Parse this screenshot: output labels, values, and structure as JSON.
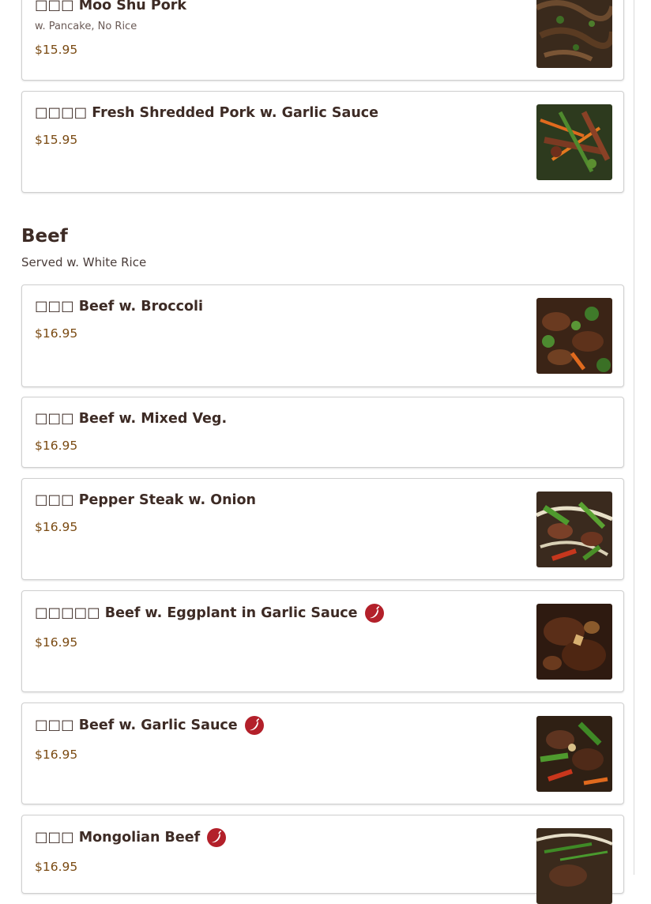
{
  "sections": {
    "previous_items": [
      {
        "name": "□□□ Moo Shu Pork",
        "description": "w. Pancake, No Rice",
        "price": "$15.95"
      },
      {
        "name": "□□□□ Fresh Shredded Pork w. Garlic Sauce",
        "price": "$15.95"
      }
    ],
    "beef": {
      "title": "Beef",
      "subtitle": "Served w. White Rice",
      "items": [
        {
          "name": "□□□ Beef w. Broccoli",
          "price": "$16.95"
        },
        {
          "name": "□□□ Beef w. Mixed Veg.",
          "price": "$16.95"
        },
        {
          "name": "□□□ Pepper Steak w. Onion",
          "price": "$16.95"
        },
        {
          "name": "□□□□□ Beef w. Eggplant in Garlic Sauce",
          "price": "$16.95",
          "spicy": true
        },
        {
          "name": "□□□ Beef w. Garlic Sauce",
          "price": "$16.95",
          "spicy": true
        },
        {
          "name": "□□□ Mongolian Beef",
          "price": "$16.95",
          "spicy": true
        }
      ]
    }
  },
  "icons": {
    "spicy": "chili-pepper-icon"
  },
  "colors": {
    "price": "#7a4a12",
    "spicy_badge": "#b3202a",
    "title": "#3d2b25"
  }
}
